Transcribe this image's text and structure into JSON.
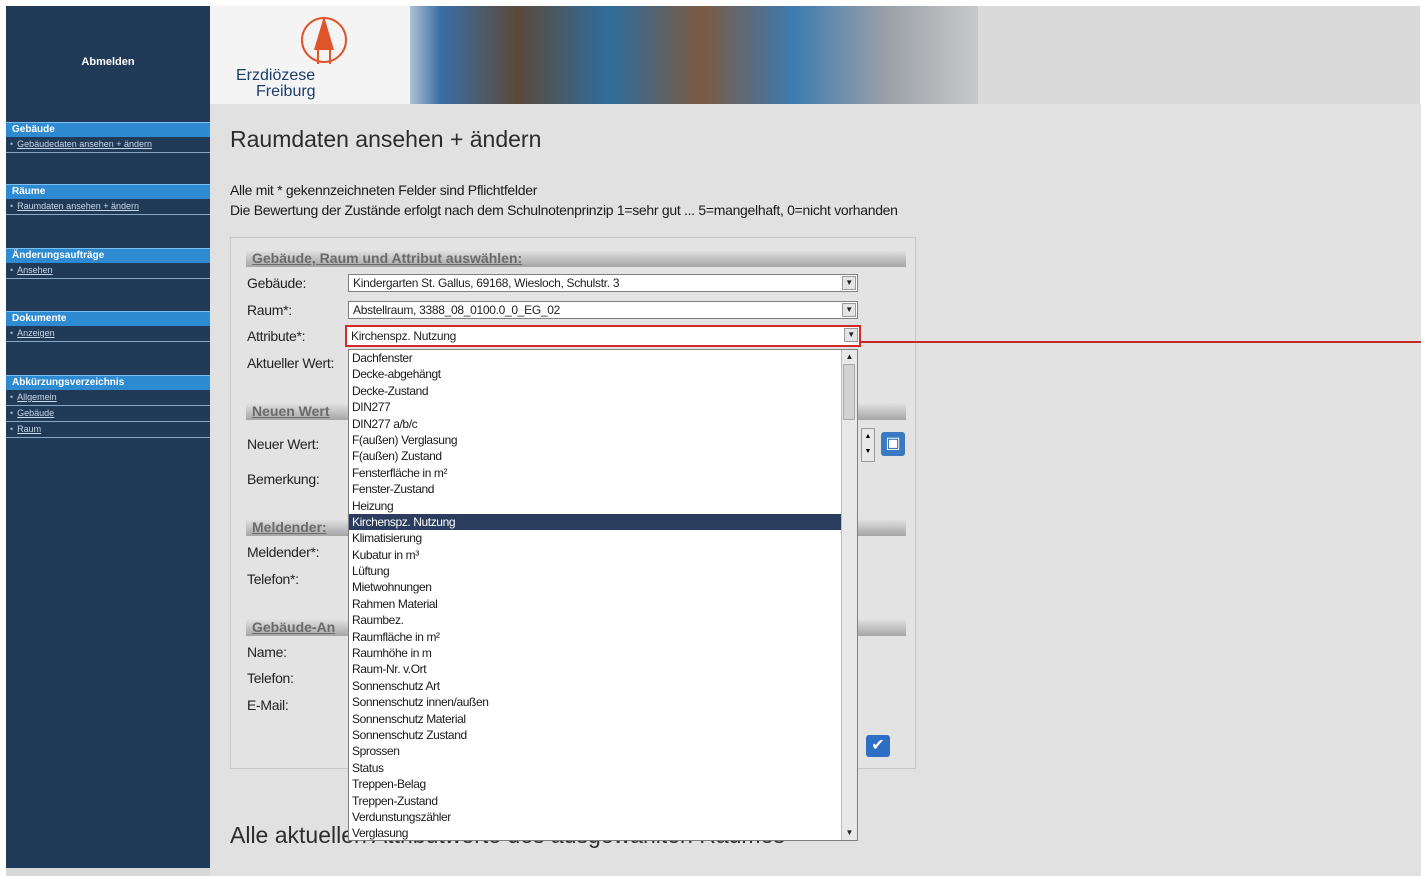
{
  "sidebar": {
    "logout": "Abmelden",
    "sections": [
      {
        "title": "Gebäude",
        "items": [
          "Gebäudedaten ansehen + ändern"
        ]
      },
      {
        "title": "Räume",
        "items": [
          "Raumdaten ansehen + ändern"
        ]
      },
      {
        "title": "Änderungsaufträge",
        "items": [
          "Ansehen"
        ]
      },
      {
        "title": "Dokumente",
        "items": [
          "Anzeigen"
        ]
      },
      {
        "title": "Abkürzungsverzeichnis",
        "items": [
          "Allgemein",
          "Gebäude",
          "Raum"
        ]
      }
    ]
  },
  "banner": {
    "logo_line1": "Erzdiözese",
    "logo_line2": "Freiburg"
  },
  "page": {
    "title": "Raumdaten ansehen + ändern",
    "info1": "Alle mit * gekennzeichneten Felder sind Pflichtfelder",
    "info2": "Die Bewertung der Zustände erfolgt nach dem Schulnotenprinzip 1=sehr gut ... 5=mangelhaft, 0=nicht vorhanden",
    "second_title": "Alle aktuellen Attributwerte des ausgewählten Raumes"
  },
  "form": {
    "group1": "Gebäude, Raum und Attribut auswählen:",
    "group2": "Neuen Wert",
    "group3": "Meldender:",
    "group4": "Gebäude-An",
    "labels": {
      "gebaeude": "Gebäude:",
      "raum": "Raum*:",
      "attribute": "Attribute*:",
      "aktueller_wert": "Aktueller Wert:",
      "neuer_wert": "Neuer Wert:",
      "bemerkung": "Bemerkung:",
      "meldender": "Meldender*:",
      "telefon": "Telefon*:",
      "name": "Name:",
      "telefon2": "Telefon:",
      "email": "E-Mail:"
    },
    "gebaeude_value": "Kindergarten St. Gallus, 69168, Wiesloch, Schulstr. 3",
    "raum_value": "Abstellraum, 3388_08_0100.0_0_EG_02",
    "attribute_value": "Kirchenspz. Nutzung"
  },
  "dropdown": {
    "options": [
      "Dachfenster",
      "Decke-abgehängt",
      "Decke-Zustand",
      "DIN277",
      "DIN277 a/b/c",
      "F(außen) Verglasung",
      "F(außen) Zustand",
      "Fensterfläche in m²",
      "Fenster-Zustand",
      "Heizung",
      "Kirchenspz. Nutzung",
      "Klimatisierung",
      "Kubatur in m³",
      "Lüftung",
      "Mietwohnungen",
      "Rahmen Material",
      "Raumbez.",
      "Raumfläche in m²",
      "Raumhöhe in m",
      "Raum-Nr. v.Ort",
      "Sonnenschutz Art",
      "Sonnenschutz innen/außen",
      "Sonnenschutz Material",
      "Sonnenschutz Zustand",
      "Sprossen",
      "Status",
      "Treppen-Belag",
      "Treppen-Zustand",
      "Verdunstungszähler",
      "Verglasung"
    ],
    "selected": "Kirchenspz. Nutzung"
  },
  "colors": {
    "sidebar": "#203a58",
    "section_header": "#2e8bd1",
    "selected_option": "#2a3d5e",
    "callout": "#c62828"
  }
}
